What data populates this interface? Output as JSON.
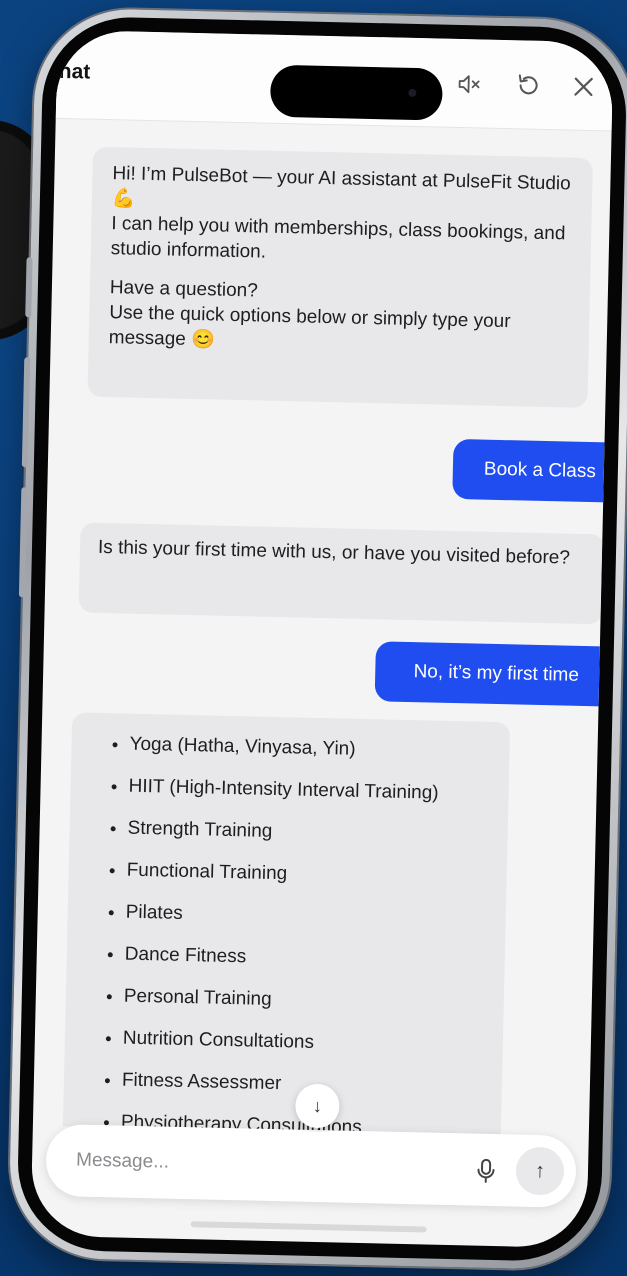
{
  "header": {
    "title": "hat",
    "mute_icon": "speaker-mute-icon",
    "reset_icon": "refresh-icon",
    "close_icon": "close-icon"
  },
  "messages": {
    "welcome": {
      "line1": "Hi! I’m PulseBot — your AI assistant at PulseFit Studio 💪",
      "line2": "I can help you with memberships, class bookings, and studio information.",
      "line3": "Have a question?",
      "line4": "Use the quick options below or simply type your message 😊"
    },
    "user1": "Book a Class",
    "bot2": "Is this your first time with us, or have you visited before?",
    "user2": "No, it’s my first time",
    "services": [
      "Yoga (Hatha, Vinyasa, Yin)",
      "HIIT (High-Intensity Interval Training)",
      "Strength Training",
      "Functional Training",
      "Pilates",
      "Dance Fitness",
      "Personal Training",
      "Nutrition Consultations",
      "Fitness Assessmer",
      "Physiotherapy Consultations"
    ]
  },
  "composer": {
    "placeholder": "Message...",
    "mic_icon": "microphone-icon",
    "send_icon": "arrow-up-icon"
  },
  "scroll_icon": "arrow-down-icon",
  "colors": {
    "accent": "#1f4df0",
    "background": "#0a3f7a",
    "bubble": "#e8e8ea"
  }
}
